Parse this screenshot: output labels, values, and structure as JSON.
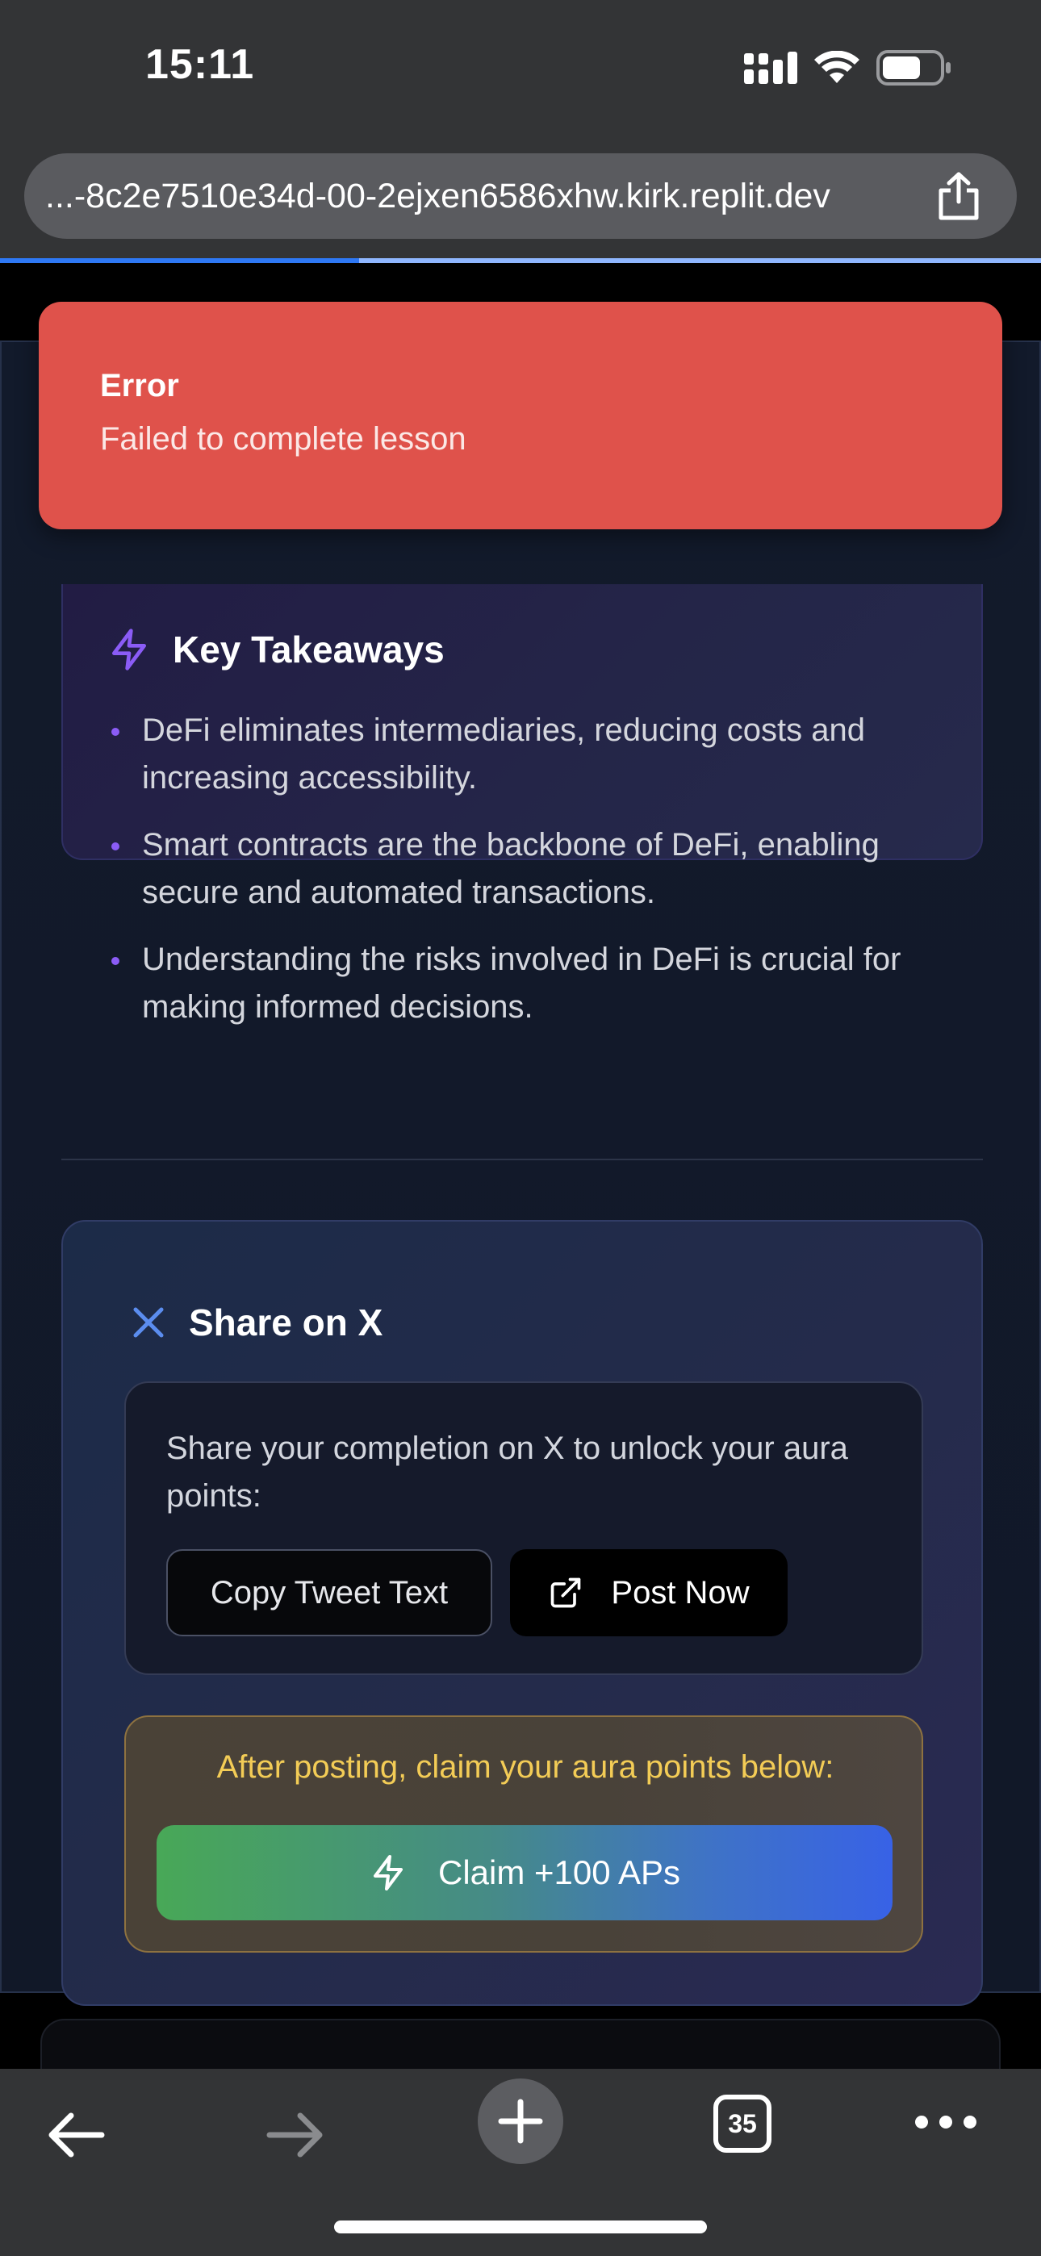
{
  "status_bar": {
    "time": "15:11",
    "signal_icon": "cellular-signal-icon",
    "wifi_icon": "wifi-icon",
    "battery_icon": "battery-icon"
  },
  "browser": {
    "url": "...-8c2e7510e34d-00-2ejxen6586xhw.kirk.replit.dev",
    "share_icon": "share-icon",
    "load_progress": 0.345
  },
  "toast": {
    "title": "Error",
    "message": "Failed to complete lesson",
    "color": "#df524b"
  },
  "takeaways": {
    "icon": "lightning-icon",
    "title": "Key Takeaways",
    "items": [
      "DeFi eliminates intermediaries, reducing costs and increasing accessibility.",
      "Smart contracts are the backbone of DeFi, enabling secure and automated transactions.",
      "Understanding the risks involved in DeFi is crucial for making informed decisions."
    ],
    "accent": "#8b5cf6"
  },
  "share": {
    "icon": "x-logo-icon",
    "title": "Share on X",
    "description": "Share your completion on X to unlock your aura points:",
    "copy_label": "Copy Tweet Text",
    "post_label": "Post Now",
    "post_icon": "external-link-icon"
  },
  "claim": {
    "note": "After posting, claim your aura points below:",
    "button_label": "Claim +100 APs",
    "button_icon": "lightning-icon",
    "note_color": "#f3cc56"
  },
  "toolbar": {
    "back_icon": "back-arrow-icon",
    "forward_icon": "forward-arrow-icon",
    "new_tab_icon": "plus-icon",
    "tab_count": "35",
    "more_icon": "more-dots-icon"
  }
}
